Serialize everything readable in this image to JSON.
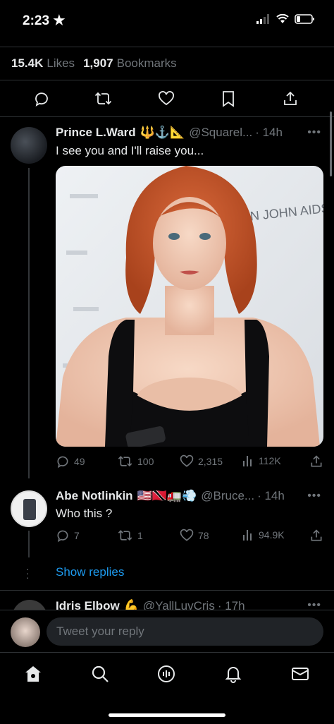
{
  "status_bar": {
    "time": "2:23"
  },
  "stats": {
    "likes_count": "15.4K",
    "likes_label": "Likes",
    "bookmarks_count": "1,907",
    "bookmarks_label": "Bookmarks"
  },
  "tweets": [
    {
      "name": "Prince L.Ward",
      "emoji": "🔱⚓📐",
      "handle": "@Squarel...",
      "time": "· 14h",
      "text": "I see you and I'll raise you...",
      "media_text": "ON JOHN AIDS",
      "replies": "49",
      "retweets": "100",
      "likes": "2,315",
      "views": "112K"
    },
    {
      "name": "Abe Notlinkin",
      "emoji": "🇺🇸🇹🇹🚛💨",
      "handle": "@Bruce...",
      "time": "· 14h",
      "text": "Who this ?",
      "replies": "7",
      "retweets": "1",
      "likes": "78",
      "views": "94.9K"
    },
    {
      "name": "Idris Elbow",
      "emoji": "💪",
      "handle": "@YallLuvCris",
      "time": "· 17h"
    }
  ],
  "show_replies": "Show replies",
  "reply_bar": {
    "placeholder": "Tweet your reply"
  },
  "colors": {
    "accent": "#1d9bf0",
    "background": "#000000",
    "muted": "#71767b"
  }
}
